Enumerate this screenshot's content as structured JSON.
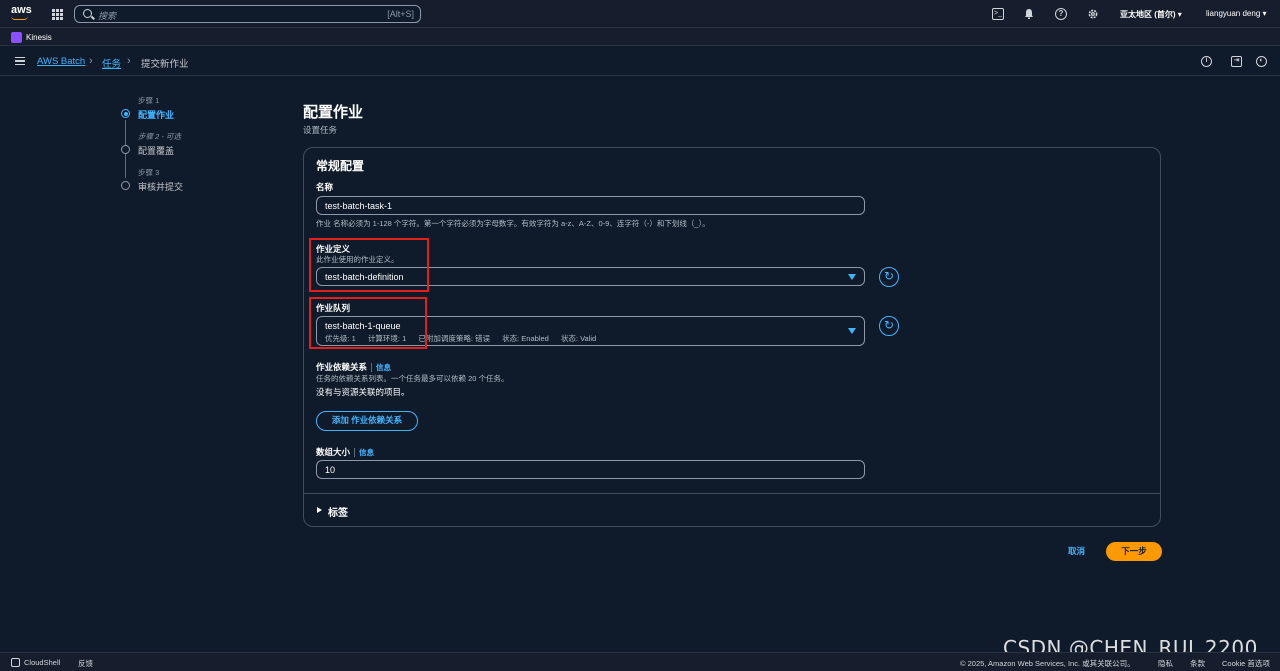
{
  "topbar": {
    "logo_text": "aws",
    "search_placeholder": "搜索",
    "search_shortcut": "[Alt+S]",
    "region": "亚太地区 (首尔) ▾",
    "user": "liangyuan deng ▾",
    "icons": [
      "cloudshell-icon",
      "bell-icon",
      "help-icon",
      "gear-icon"
    ]
  },
  "service": {
    "name": "Kinesis"
  },
  "breadcrumb": {
    "items": [
      "AWS Batch",
      "任务"
    ],
    "current": "提交新作业"
  },
  "steps": [
    {
      "small": "步骤 1",
      "label": "配置作业"
    },
    {
      "small": "步骤 2 - 可选",
      "label": "配置覆盖"
    },
    {
      "small": "步骤 3",
      "label": "审核并提交"
    }
  ],
  "header": {
    "title": "配置作业",
    "subtitle": "设置任务"
  },
  "form": {
    "section_title": "常规配置",
    "name_label": "名称",
    "name_value": "test-batch-task-1",
    "name_hint": "作业 名称必须为 1-128 个字符。第一个字符必须为字母数字。有效字符为 a-z、A-Z、0-9、连字符（-）和下划线（_）。",
    "jobdef_label": "作业定义",
    "jobdef_desc": "此作业使用的作业定义。",
    "jobdef_value": "test-batch-definition",
    "queue_label": "作业队列",
    "queue_value": "test-batch-1-queue",
    "queue_meta": [
      "优先级: 1",
      "计算环境: 1",
      "已附加调度策略: 错误",
      "状态: Enabled",
      "状态: Valid"
    ],
    "deps_label": "作业依赖关系",
    "info_link": "信息",
    "deps_desc": "任务的依赖关系列表。一个任务最多可以依赖 20 个任务。",
    "deps_empty": "没有与资源关联的项目。",
    "deps_add_button": "添加 作业依赖关系",
    "array_label": "数组大小",
    "array_value": "10",
    "tags_label": "标签"
  },
  "actions": {
    "cancel": "取消",
    "next": "下一步"
  },
  "footer": {
    "cloudshell": "CloudShell",
    "feedback": "反馈",
    "copyright": "© 2025, Amazon Web Services, Inc. 或其关联公司。",
    "privacy": "隐私",
    "terms": "条款",
    "cookie": "Cookie 首选项"
  },
  "watermark": "CSDN @CHEN_RUI_2200",
  "colors": {
    "accent": "#42b4ff",
    "primary_button": "#ff9900",
    "highlight_box": "#e0201b",
    "background": "#0f1b2a"
  }
}
